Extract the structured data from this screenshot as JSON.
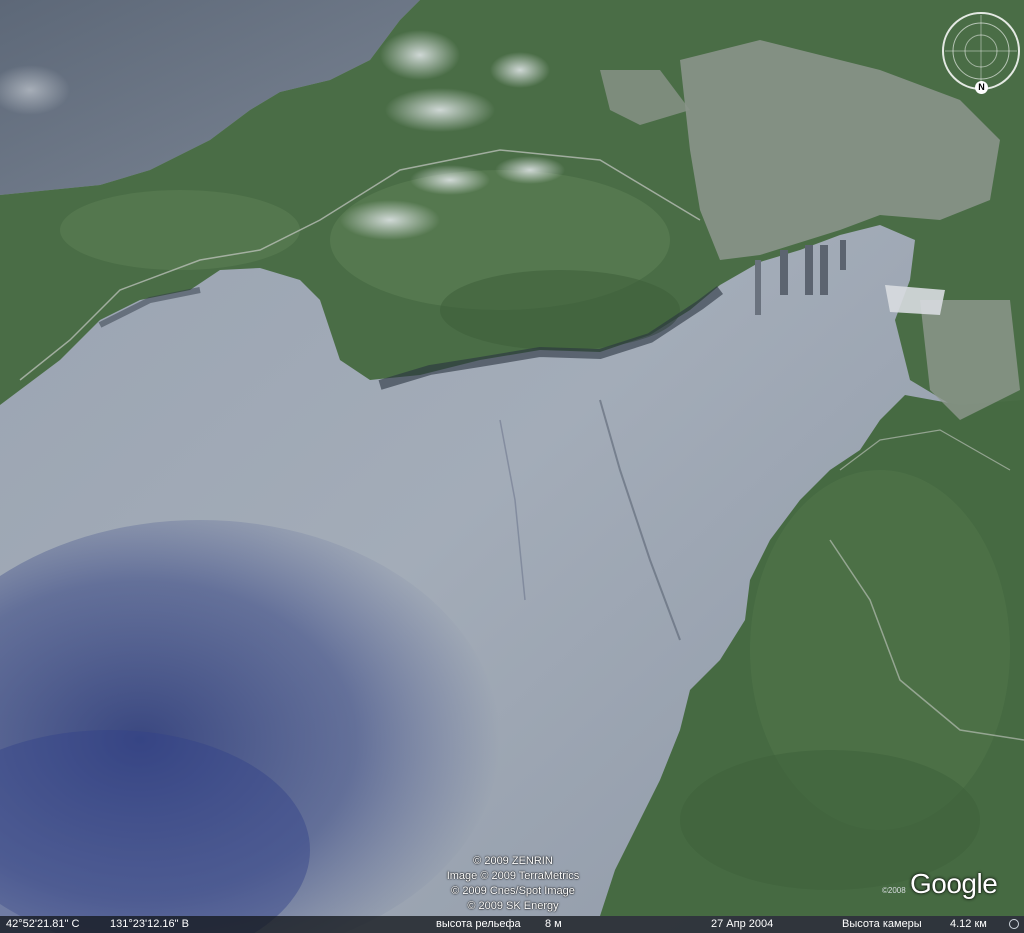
{
  "attribution": [
    "© 2009 ZENRIN",
    "Image © 2009 TerraMetrics",
    "© 2009 Cnes/Spot Image",
    "© 2009 SK Energy"
  ],
  "logo": {
    "text": "Google",
    "year": "©2008"
  },
  "status": {
    "latitude": "42°52'21.81\" С",
    "longitude": "131°23'12.16\" В",
    "elevation_label": "высота рельефа",
    "elevation_value": "8 м",
    "date": "27 Апр 2004",
    "eye_label": "Высота камеры",
    "eye_value": "4.12 км"
  },
  "compass": {
    "north_label": "N"
  },
  "colors": {
    "water": "#8a93a0",
    "water_dark": "#3f4e86",
    "land": "#466a44",
    "land_light": "#5d8455",
    "urban": "#9aa29c",
    "status_bar": "#14181e"
  }
}
